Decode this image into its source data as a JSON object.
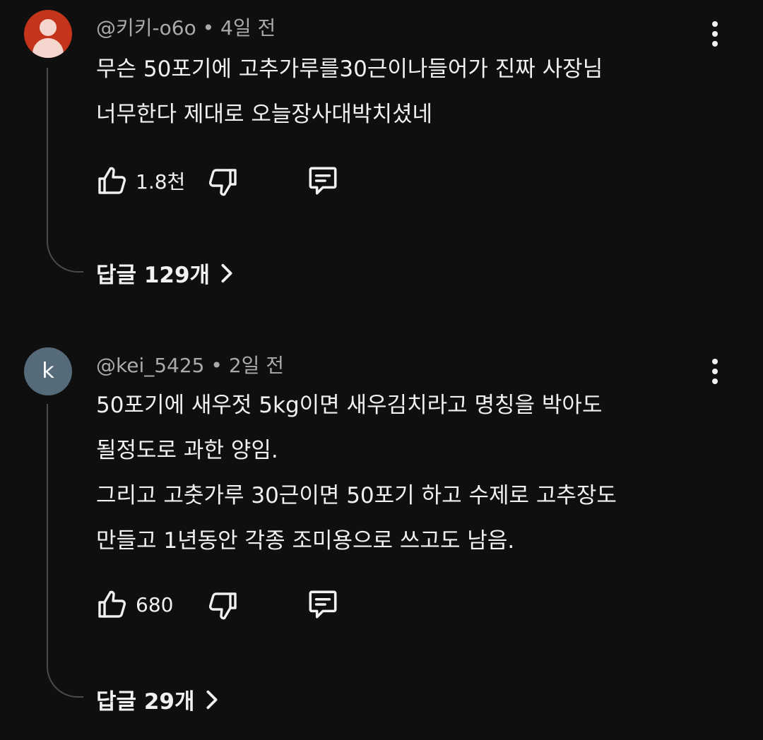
{
  "comments": [
    {
      "author": "@키키-o6o",
      "separator": "•",
      "time": "4일 전",
      "avatar_icon": "person-icon",
      "avatar_color": "#c4341b",
      "text": "무슨 50포기에 고추가루를30근이나들어가  진짜 사장님\n너무한다 제대로 오늘장사대박치셨네",
      "likes": "1.8천",
      "replies_label": "답글 129개"
    },
    {
      "author": "@kei_5425",
      "separator": "•",
      "time": "2일 전",
      "avatar_initial": "k",
      "avatar_color": "#566b7a",
      "text": "50포기에 새우젓 5kg이면 새우김치라고 명칭을 박아도\n될정도로 과한 양임.\n그리고 고춧가루 30근이면 50포기 하고 수제로 고추장도\n만들고 1년동안 각종 조미용으로 쓰고도 남음.",
      "likes": "680",
      "replies_label": "답글 29개"
    }
  ],
  "icons": {
    "like": "thumbs-up-icon",
    "dislike": "thumbs-down-icon",
    "reply": "comment-icon",
    "menu": "more-vertical-icon",
    "chevron": "chevron-right-icon"
  },
  "colors": {
    "background": "#0f0f0f",
    "text_primary": "#f1f1f1",
    "text_secondary": "#aaaaaa",
    "thread_line": "#4a4a4a"
  }
}
